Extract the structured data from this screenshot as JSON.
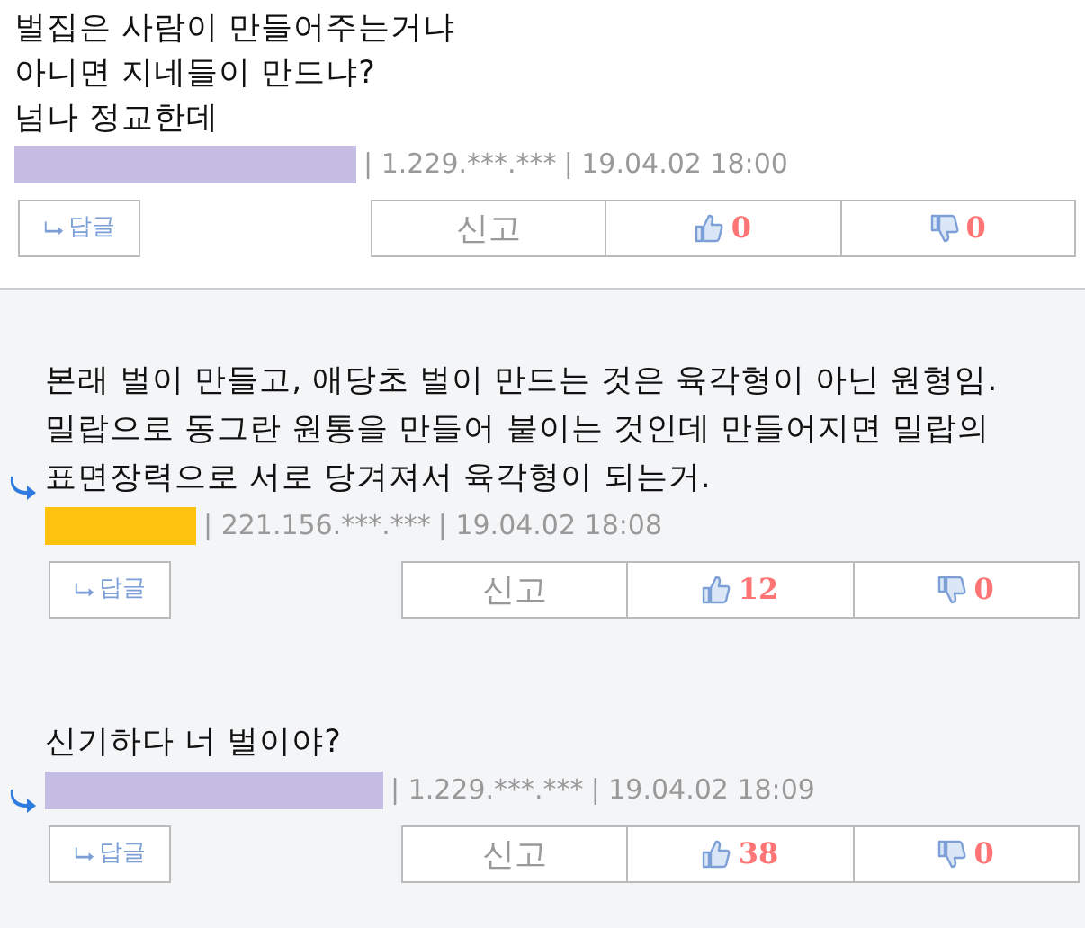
{
  "comments": [
    {
      "reply": false,
      "lines": [
        "벌집은 사람이 만들어주는거냐",
        "아니면 지네들이 만드냐?",
        "넘나 정교한데"
      ],
      "name_mask": {
        "color": "#c5bde4"
      },
      "ip": "| 1.229.***.***",
      "date": "| 19.04.02 18:00",
      "reply_button": "답글",
      "report_button": "신고",
      "likes": "0",
      "dislikes": "0"
    },
    {
      "reply": true,
      "lines": [
        "본래 벌이 만들고, 애당초 벌이 만드는 것은 육각형이 아닌 원형임.",
        "밀랍으로 동그란 원통을 만들어 붙이는 것인데 만들어지면 밀랍의",
        "표면장력으로 서로 당겨져서 육각형이 되는거."
      ],
      "name_mask": {
        "color": "#ffc30f"
      },
      "ip": "| 221.156.***.***",
      "date": "| 19.04.02 18:08",
      "reply_button": "답글",
      "report_button": "신고",
      "likes": "12",
      "dislikes": "0"
    },
    {
      "reply": true,
      "lines": [
        "신기하다 너 벌이야?"
      ],
      "name_mask": {
        "color": "#c5bde4"
      },
      "ip": "| 1.229.***.***",
      "date": "| 19.04.02 18:09",
      "reply_button": "답글",
      "report_button": "신고",
      "likes": "38",
      "dislikes": "0"
    }
  ]
}
